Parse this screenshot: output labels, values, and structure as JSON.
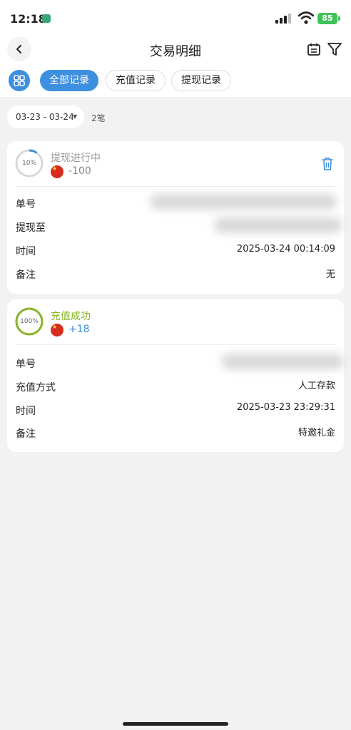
{
  "status_bar": {
    "time": "12:18",
    "battery": "85"
  },
  "header": {
    "title": "交易明细"
  },
  "tabs": [
    {
      "label": "全部记录",
      "active": true
    },
    {
      "label": "充值记录",
      "active": false
    },
    {
      "label": "提现记录",
      "active": false
    }
  ],
  "filter": {
    "date_range": "03-23 - 03-24",
    "count": "2笔"
  },
  "records": [
    {
      "progress_label": "10%",
      "progress": 0.1,
      "status": "提现进行中",
      "amount": "-100",
      "rows": [
        {
          "label": "单号",
          "value": ""
        },
        {
          "label": "提现至",
          "value": ""
        },
        {
          "label": "时间",
          "value": "2025-03-24 00:14:09"
        },
        {
          "label": "备注",
          "value": "无"
        }
      ]
    },
    {
      "progress_label": "100%",
      "progress": 1.0,
      "status": "充值成功",
      "amount": "+18",
      "rows": [
        {
          "label": "单号",
          "value": ""
        },
        {
          "label": "充值方式",
          "value": "人工存款"
        },
        {
          "label": "时间",
          "value": "2025-03-23 23:29:31"
        },
        {
          "label": "备注",
          "value": "特邀礼金"
        }
      ]
    }
  ],
  "colors": {
    "accent": "#3d8fe0",
    "success": "#8ab42a",
    "pending_text": "#999999",
    "amount_blue": "#3d8fe0"
  },
  "icons": [
    "back-icon",
    "calendar-icon",
    "filter-icon",
    "grid-icon",
    "trash-icon",
    "china-flag-icon"
  ]
}
